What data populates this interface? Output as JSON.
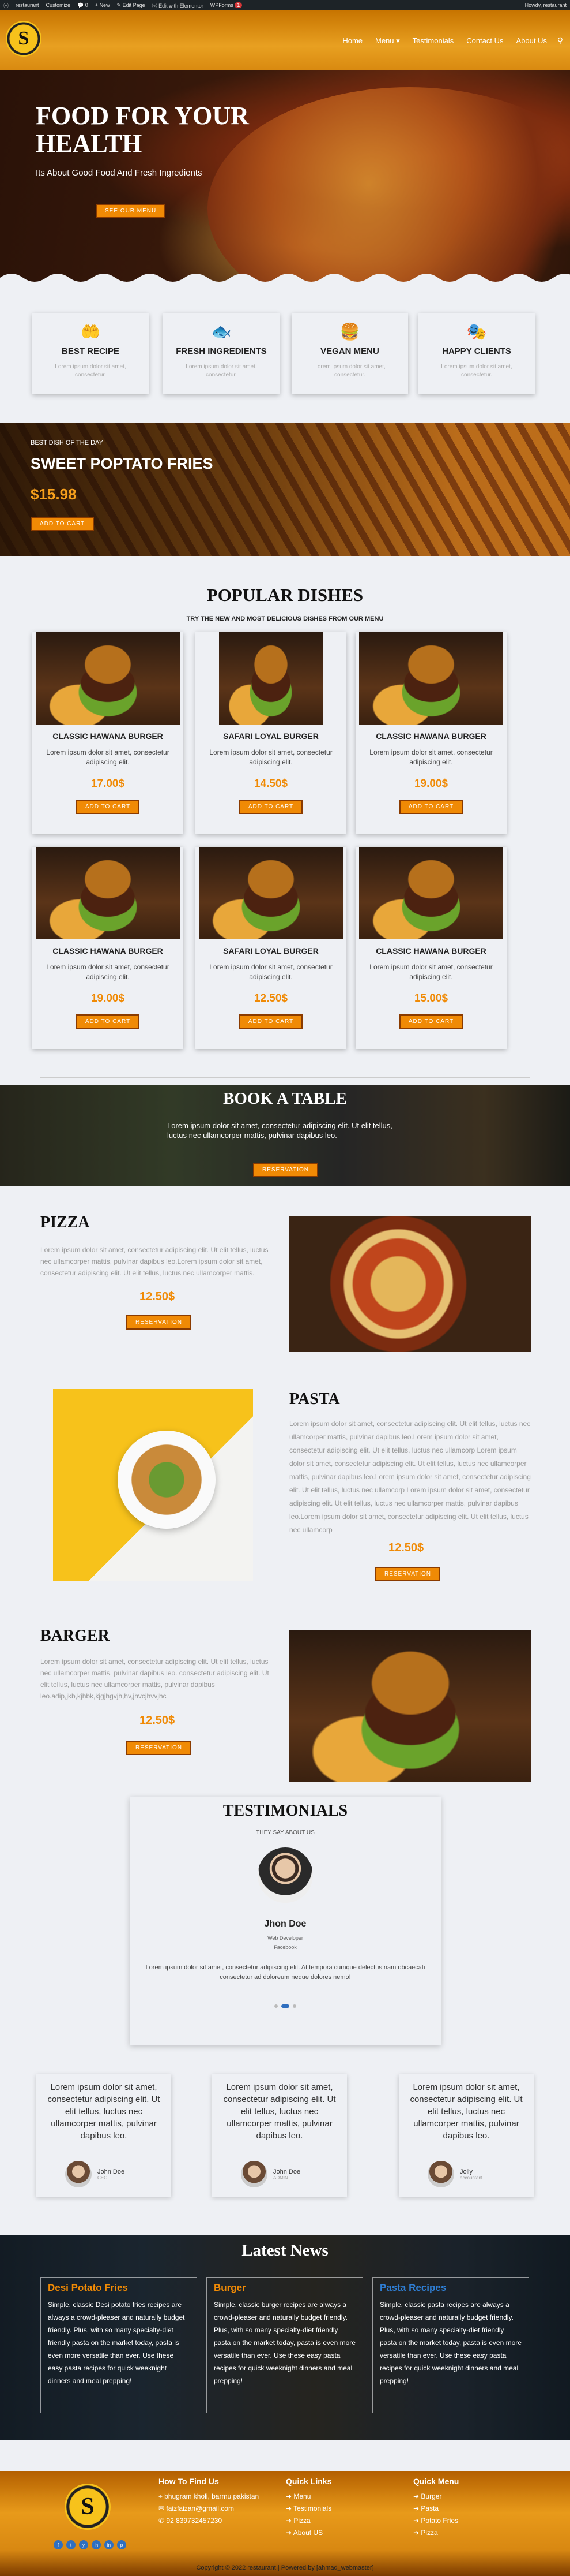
{
  "adminbar": {
    "site": "restaurant",
    "customize": "Customize",
    "comments": "0",
    "new": "New",
    "edit": "Edit Page",
    "elementor": "Edit with Elementor",
    "wpforms": "WPForms",
    "wpforms_badge": "1",
    "howdy": "Howdy, restaurant"
  },
  "header": {
    "logo_letter": "S",
    "nav": [
      "Home",
      "Menu ▾",
      "Testimonials",
      "Contact Us",
      "About Us"
    ],
    "search_icon": "search-icon"
  },
  "hero": {
    "title": "FOOD FOR YOUR HEALTH",
    "subtitle": "Its About Good Food And Fresh Ingredients",
    "button": "SEE OUR MENU"
  },
  "features": [
    {
      "icon": "hand-heart-icon",
      "title": "BEST RECIPE",
      "text": "Lorem ipsum dolor sit amet, consectetur."
    },
    {
      "icon": "fish-icon",
      "title": "FRESH INGREDIENTS",
      "text": "Lorem ipsum dolor sit amet, consectetur."
    },
    {
      "icon": "burger-icon",
      "title": "VEGAN MENU",
      "text": "Lorem ipsum dolor sit amet, consectetur."
    },
    {
      "icon": "masks-icon",
      "title": "HAPPY CLIENTS",
      "text": "Lorem ipsum dolor sit amet, consectetur."
    }
  ],
  "promo": {
    "kicker": "BEST DISH OF THE DAY",
    "title": "SWEET POPTATO FRIES",
    "price": "$15.98",
    "button": "ADD TO CART"
  },
  "popular": {
    "title": "POPULAR DISHES",
    "subtitle": "TRY THE NEW AND MOST DELICIOUS DISHES FROM OUR MENU",
    "dishes": [
      {
        "name": "CLASSIC HAWANA BURGER",
        "text": "Lorem ipsum dolor sit amet, consectetur adipiscing elit.",
        "price": "17.00$",
        "button": "ADD TO CART"
      },
      {
        "name": "SAFARI LOYAL BURGER",
        "text": "Lorem ipsum dolor sit amet, consectetur adipiscing elit.",
        "price": "14.50$",
        "button": "ADD TO CART"
      },
      {
        "name": "CLASSIC HAWANA BURGER",
        "text": "Lorem ipsum dolor sit amet, consectetur adipiscing elit.",
        "price": "19.00$",
        "button": "ADD TO CART"
      },
      {
        "name": "CLASSIC HAWANA BURGER",
        "text": "Lorem ipsum dolor sit amet, consectetur adipiscing elit.",
        "price": "19.00$",
        "button": "ADD TO CART"
      },
      {
        "name": "SAFARI LOYAL BURGER",
        "text": "Lorem ipsum dolor sit amet, consectetur adipiscing elit.",
        "price": "12.50$",
        "button": "ADD TO CART"
      },
      {
        "name": "CLASSIC HAWANA BURGER",
        "text": "Lorem ipsum dolor sit amet, consectetur adipiscing elit.",
        "price": "15.00$",
        "button": "ADD TO CART"
      }
    ]
  },
  "book": {
    "title": "BOOK A TABLE",
    "text": "Lorem ipsum dolor sit amet, consectetur adipiscing elit. Ut elit tellus, luctus nec ullamcorper mattis, pulvinar dapibus leo.",
    "button": "RESERVATION"
  },
  "pizza": {
    "title": "PIZZA",
    "text": "Lorem ipsum dolor sit amet, consectetur adipiscing elit. Ut elit tellus, luctus nec ullamcorper mattis, pulvinar dapibus leo.Lorem ipsum dolor sit amet, consectetur adipiscing elit. Ut elit tellus, luctus nec ullamcorper mattis.",
    "price": "12.50$",
    "button": "RESERVATION"
  },
  "pasta": {
    "title": "PASTA",
    "text": "Lorem ipsum dolor sit amet, consectetur adipiscing elit. Ut elit tellus, luctus nec ullamcorper mattis, pulvinar dapibus leo.Lorem ipsum dolor sit amet, consectetur adipiscing elit. Ut elit tellus, luctus nec ullamcorp Lorem ipsum dolor sit amet, consectetur adipiscing elit. Ut elit tellus, luctus nec ullamcorper mattis, pulvinar dapibus leo.Lorem ipsum dolor sit amet, consectetur adipiscing elit. Ut elit tellus, luctus nec ullamcorp Lorem ipsum dolor sit amet, consectetur adipiscing elit. Ut elit tellus, luctus nec ullamcorper mattis, pulvinar dapibus leo.Lorem ipsum dolor sit amet, consectetur adipiscing elit. Ut elit tellus, luctus nec ullamcorp",
    "price": "12.50$",
    "button": "RESERVATION"
  },
  "barger": {
    "title": "BARGER",
    "text": "Lorem ipsum dolor sit amet, consectetur adipiscing elit. Ut elit tellus, luctus nec ullamcorper mattis, pulvinar dapibus leo. consectetur adipiscing elit. Ut elit tellus, luctus nec ullamcorper mattis, pulvinar dapibus leo.adip,jkb,kjhbk,kjgjhgvjh,hv,jhvcjhvvjhc",
    "price": "12.50$",
    "button": "RESERVATION"
  },
  "testimonials": {
    "title": "TESTIMONIALS",
    "subtitle": "THEY SAY ABOUT US",
    "name": "Jhon Doe",
    "role": "Web Developer",
    "company": "Facebook",
    "quote": "Lorem ipsum dolor sit amet, consectetur adipiscing elit. At tempora cumque delectus nam obcaecati consectetur ad doloreum neque dolores nemo!",
    "cards": [
      {
        "text": "Lorem ipsum dolor sit amet, consectetur adipiscing elit. Ut elit tellus, luctus nec ullamcorper mattis, pulvinar dapibus leo.",
        "name": "John Doe",
        "role": "CEO"
      },
      {
        "text": "Lorem ipsum dolor sit amet, consectetur adipiscing elit. Ut elit tellus, luctus nec ullamcorper mattis, pulvinar dapibus leo.",
        "name": "John Doe",
        "role": "ADMIN"
      },
      {
        "text": "Lorem ipsum dolor sit amet, consectetur adipiscing elit. Ut elit tellus, luctus nec ullamcorper mattis, pulvinar dapibus leo.",
        "name": "Jolly",
        "role": "accountant"
      }
    ]
  },
  "news": {
    "title": "Latest News",
    "items": [
      {
        "title": "Desi Potato Fries",
        "color": "#f08a05",
        "text": "Simple, classic Desi potato fries recipes are always a crowd-pleaser and naturally budget friendly. Plus, with so many specialty-diet friendly pasta on the market today, pasta is even more versatile than ever. Use these easy pasta recipes for quick weeknight dinners and meal prepping!"
      },
      {
        "title": "Burger",
        "color": "#f08a05",
        "text": "Simple, classic burger recipes are always a crowd-pleaser and naturally budget friendly. Plus, with so many specialty-diet friendly pasta on the market today, pasta is even more versatile than ever. Use these easy pasta recipes for quick weeknight dinners and meal prepping!"
      },
      {
        "title": "Pasta Recipes",
        "color": "#2f7fd6",
        "text": "Simple, classic pasta recipes are always a crowd-pleaser and naturally budget friendly. Plus, with so many specialty-diet friendly pasta on the market today, pasta is even more versatile than ever. Use these easy pasta recipes for quick weeknight dinners and meal prepping!"
      }
    ]
  },
  "footer": {
    "logo_letter": "S",
    "find_title": "How To Find Us",
    "find_rows": [
      "bhugram kholi, barmu pakistan",
      "faizfaizan@gmail.com",
      "92 839732457230"
    ],
    "links_title": "Quick Links",
    "links": [
      "Menu",
      "Testimonials",
      "Pizza",
      "About US"
    ],
    "menu_title": "Quick Menu",
    "menu": [
      "Burger",
      "Pasta",
      "Potato Fries",
      "Pizza"
    ],
    "social": [
      "f",
      "t",
      "y",
      "in",
      "g",
      "p"
    ],
    "copyright": "Copyright © 2022 restaurant | Powered by [ahmad_webmaster]"
  }
}
